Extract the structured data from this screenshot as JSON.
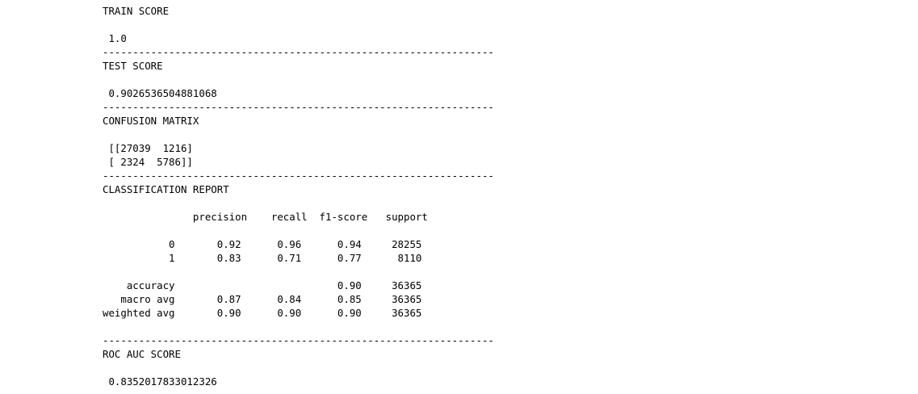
{
  "output": {
    "train_header": "TRAIN SCORE",
    "train_score": " 1.0",
    "sep1": "-----------------------------------------------------------------",
    "test_header": "TEST SCORE",
    "test_score": " 0.9026536504881068",
    "sep2": "-----------------------------------------------------------------",
    "cm_header": "CONFUSION MATRIX",
    "cm_row1": " [[27039  1216]",
    "cm_row2": " [ 2324  5786]]",
    "sep3": "-----------------------------------------------------------------",
    "cr_header": "CLASSIFICATION REPORT",
    "cr_columns": "               precision    recall  f1-score   support",
    "cr_row_0": "           0       0.92      0.96      0.94     28255",
    "cr_row_1": "           1       0.83      0.71      0.77      8110",
    "cr_accuracy": "    accuracy                           0.90     36365",
    "cr_macro_avg": "   macro avg       0.87      0.84      0.85     36365",
    "cr_weighted_avg": "weighted avg       0.90      0.90      0.90     36365",
    "sep4": "-----------------------------------------------------------------",
    "roc_header": "ROC AUC SCORE",
    "roc_score": " 0.8352017833012326"
  }
}
